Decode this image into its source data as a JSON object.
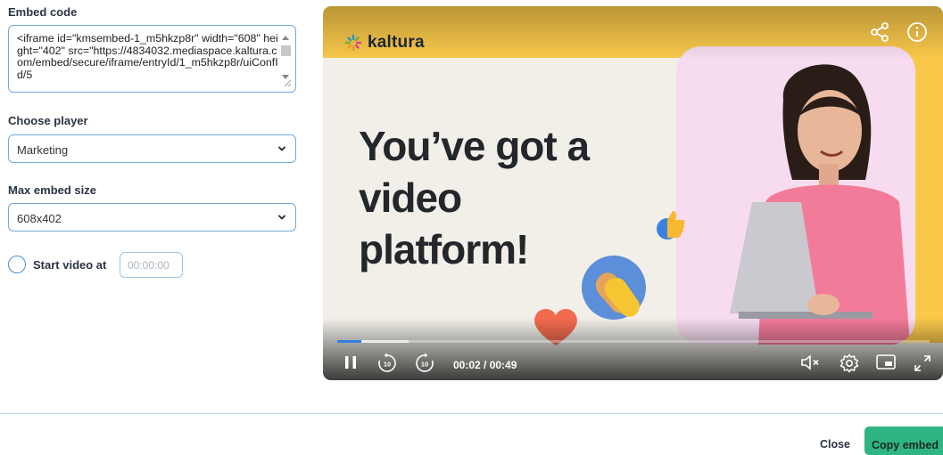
{
  "embed": {
    "label": "Embed code",
    "code": "<iframe id=\"kmsembed-1_m5hkzp8r\" width=\"608\" height=\"402\" src=\"https://4834032.mediaspace.kaltura.com/embed/secure/iframe/entryId/1_m5hkzp8r/uiConfId/5"
  },
  "player_select": {
    "label": "Choose player",
    "value": "Marketing"
  },
  "size_select": {
    "label": "Max embed size",
    "value": "608x402"
  },
  "start": {
    "label": "Start video at",
    "placeholder": "00:00:00",
    "checked": false
  },
  "video": {
    "logo": "kaltura",
    "headline": "You’ve got a video platform!",
    "time": "00:02 / 00:49",
    "progress": 0.04,
    "buffered": 0.12,
    "rewind_label": "10",
    "forward_label": "10",
    "icons": [
      "share-icon",
      "info-icon",
      "pause-icon",
      "rewind-10-icon",
      "forward-10-icon",
      "mute-icon",
      "settings-icon",
      "pip-icon",
      "fullscreen-icon"
    ]
  },
  "footer": {
    "close_label": "Close",
    "copy_label": "Copy embed"
  },
  "colors": {
    "accent_blue": "#2f7fe0",
    "border_blue": "#77a8d6",
    "copy_green": "#2fb583",
    "kaltura_yellow": "#f9c84a",
    "card_pink": "#f7dcf0"
  }
}
